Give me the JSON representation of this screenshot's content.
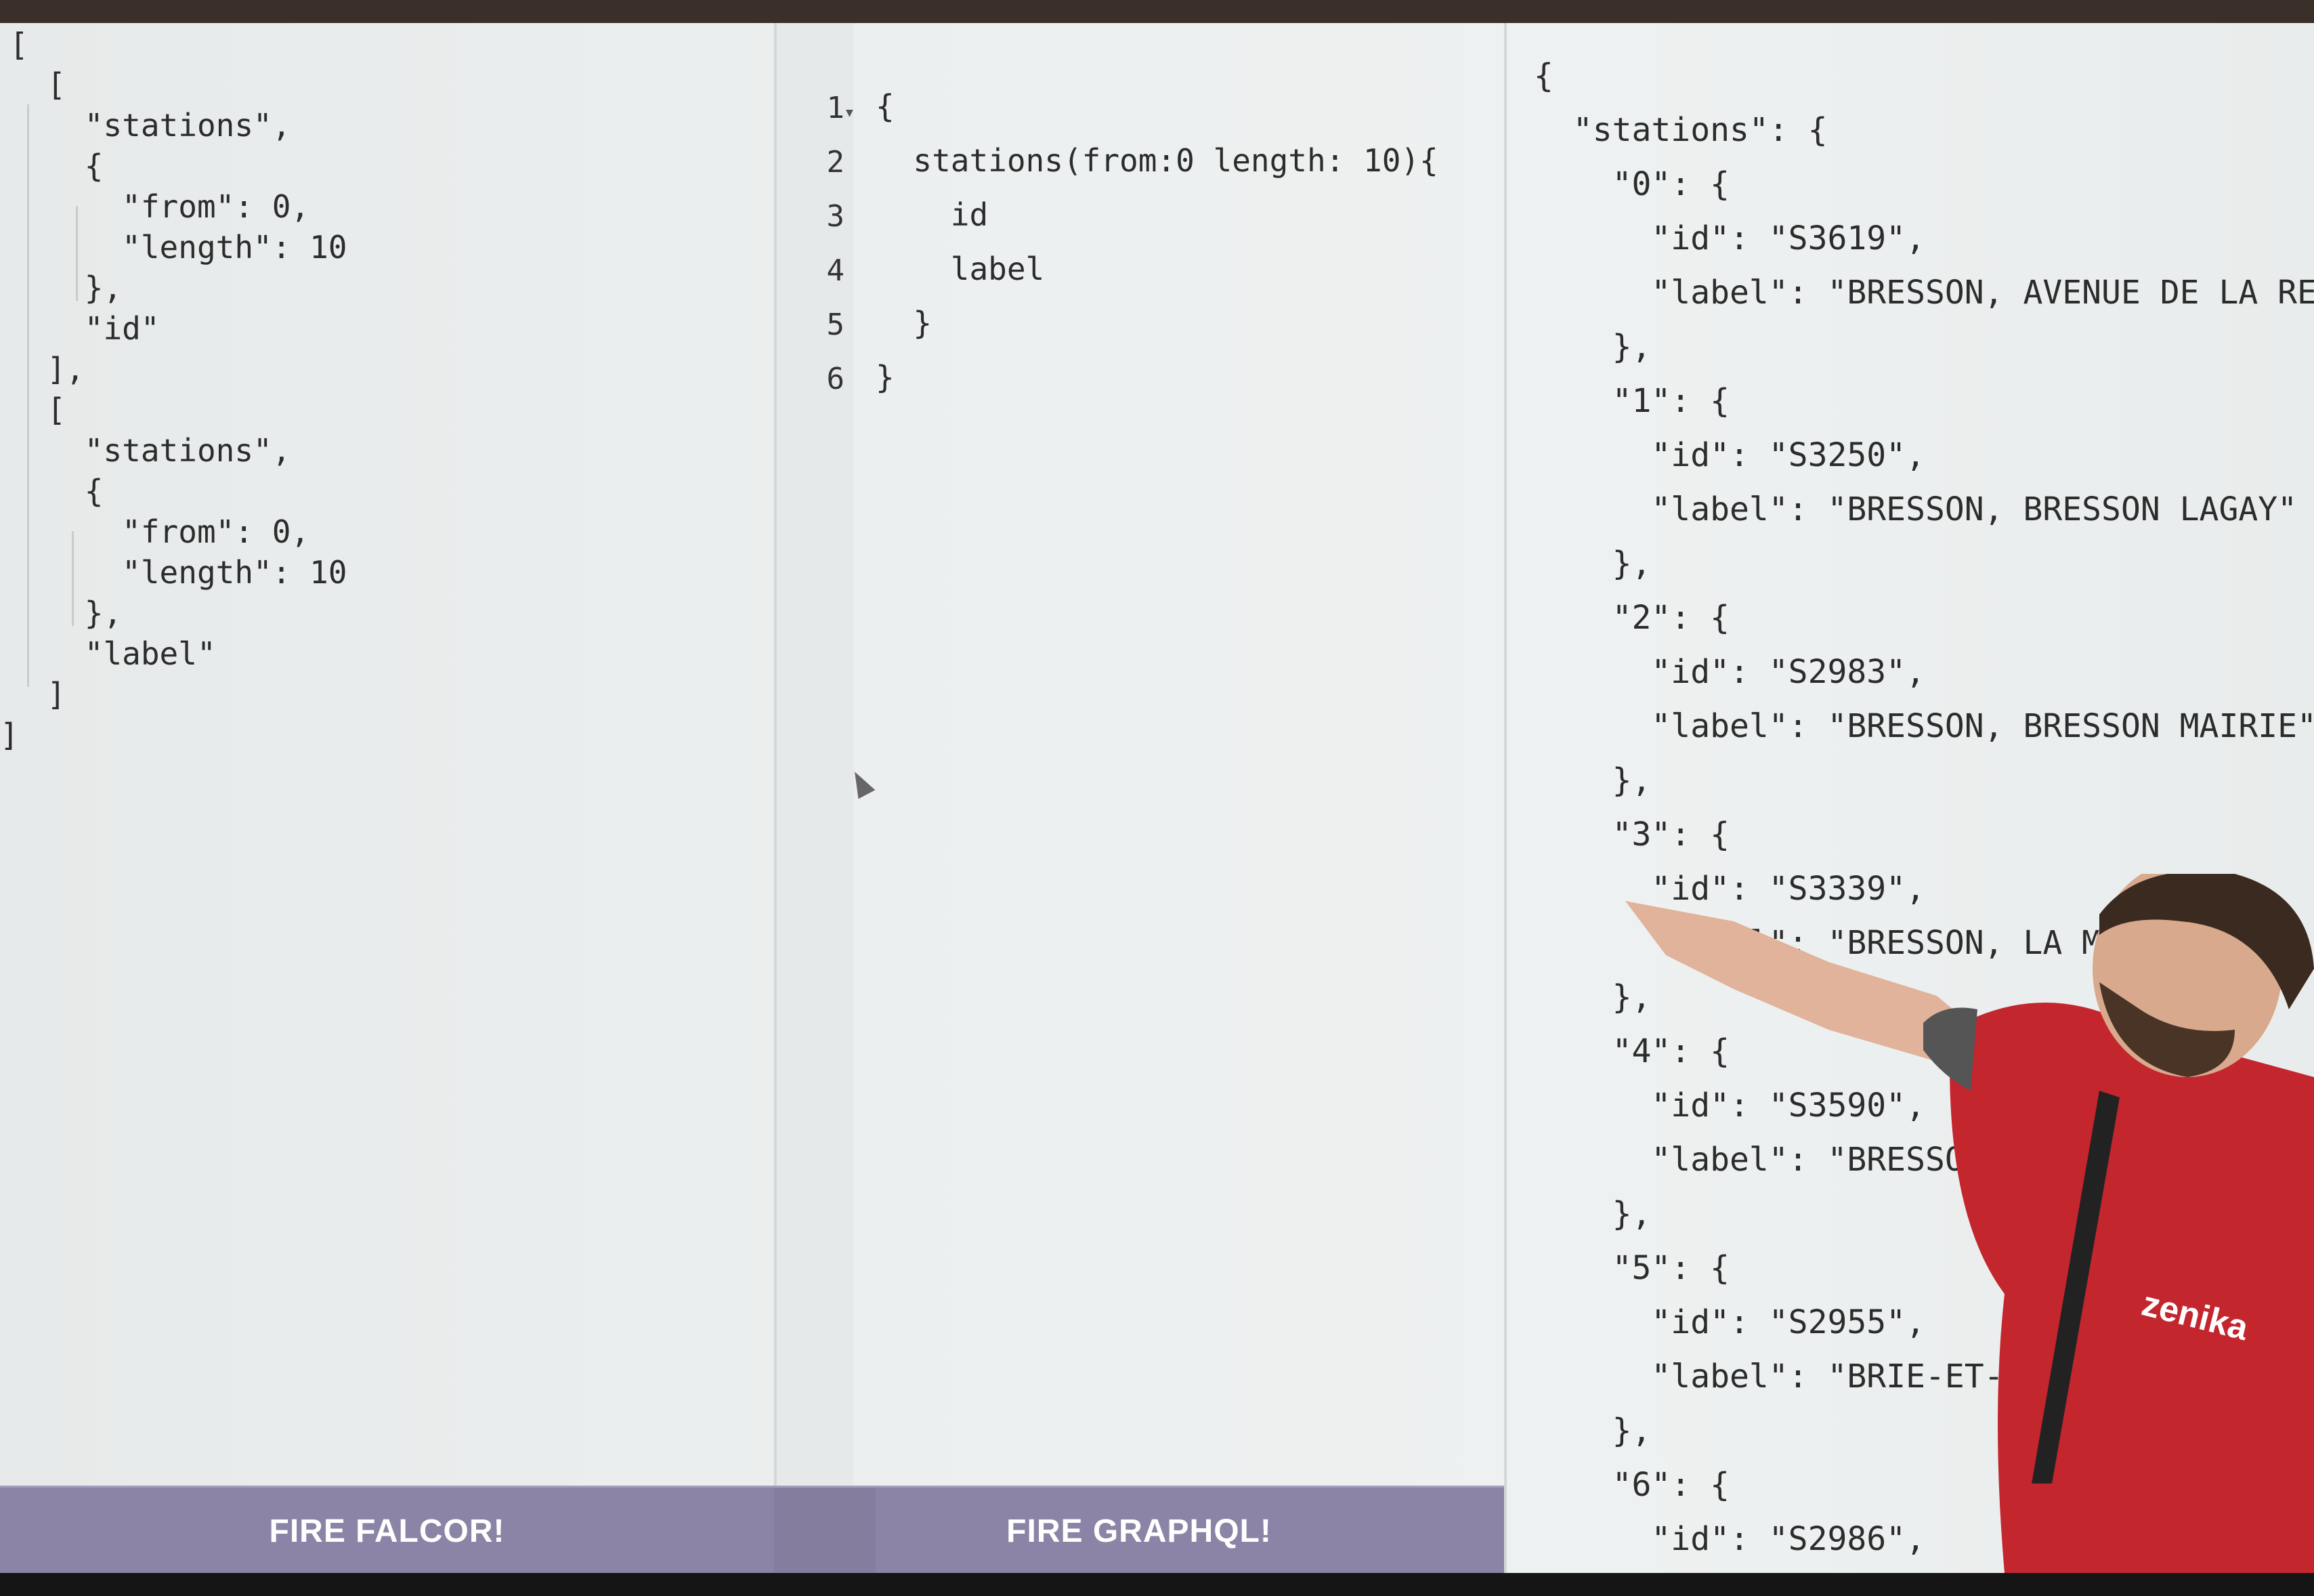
{
  "falcor_request": {
    "lines": [
      "[",
      "  [",
      "    \"stations\",",
      "    {",
      "      \"from\": 0,",
      "      \"length\": 10",
      "    },",
      "    \"id\"",
      "  ],",
      "  [",
      "    \"stations\",",
      "    {",
      "      \"from\": 0,",
      "      \"length\": 10",
      "    },",
      "    \"label\"",
      "  ]",
      "]"
    ]
  },
  "graphql_query": {
    "line_numbers": [
      "1",
      "2",
      "3",
      "4",
      "5",
      "6"
    ],
    "lines": [
      "{",
      "  stations(from:0 length: 10){",
      "    id",
      "    label",
      "  }",
      "}"
    ]
  },
  "result": {
    "lines": [
      "{",
      "  \"stations\": {",
      "    \"0\": {",
      "      \"id\": \"S3619\",",
      "      \"label\": \"BRESSON, AVENUE DE LA REP",
      "    },",
      "    \"1\": {",
      "      \"id\": \"S3250\",",
      "      \"label\": \"BRESSON, BRESSON LAGAY\"",
      "    },",
      "    \"2\": {",
      "      \"id\": \"S2983\",",
      "      \"label\": \"BRESSON, BRESSON MAIRIE\"",
      "    },",
      "    \"3\": {",
      "      \"id\": \"S3339\",",
      "      \"label\": \"BRESSON, LA MARIT",
      "    },",
      "    \"4\": {",
      "      \"id\": \"S3590\",",
      "      \"label\": \"BRESSON,",
      "    },",
      "    \"5\": {",
      "      \"id\": \"S2955\",",
      "      \"label\": \"BRIE-ET-ANGO",
      "    },",
      "    \"6\": {",
      "      \"id\": \"S2986\","
    ]
  },
  "buttons": {
    "fire_falcor": "FIRE FALCOR!",
    "fire_graphql": "FIRE GRAPHQL!"
  },
  "presenter_badge": "zenika"
}
